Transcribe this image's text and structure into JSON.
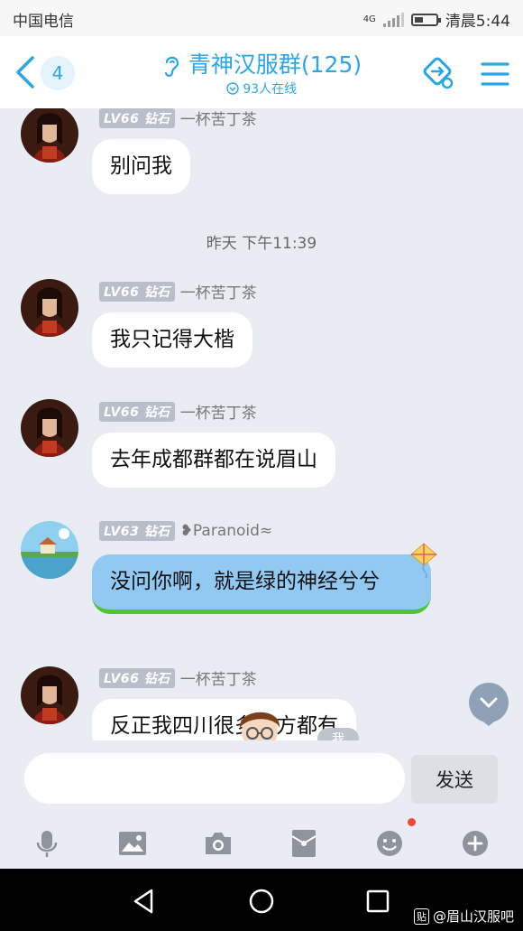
{
  "status_bar": {
    "carrier": "中国电信",
    "network": "4G",
    "time": "清晨5:44"
  },
  "header": {
    "unread_count": "4",
    "title": "青神汉服群(125)",
    "online": "93人在线"
  },
  "messages": [
    {
      "level": "LV66",
      "rank": "钻石",
      "nickname": "一杯苦丁茶",
      "text": "别问我"
    },
    {
      "level": "LV66",
      "rank": "钻石",
      "nickname": "一杯苦丁茶",
      "text": "我只记得大楷"
    },
    {
      "level": "LV66",
      "rank": "钻石",
      "nickname": "一杯苦丁茶",
      "text": "去年成都群都在说眉山"
    },
    {
      "level": "LV63",
      "rank": "钻石",
      "nickname": "❥Paranoid≈",
      "text": "没问你啊，就是绿的神经兮兮"
    },
    {
      "level": "LV66",
      "rank": "钻石",
      "nickname": "一杯苦丁茶",
      "text": "反正我四川很多地方都有"
    }
  ],
  "timestamp": "昨天 下午11:39",
  "me_tag": "我",
  "input": {
    "placeholder": "",
    "send_label": "发送"
  },
  "toolbar": {
    "icons": [
      "microphone-icon",
      "image-icon",
      "camera-icon",
      "red-packet-icon",
      "emoji-icon",
      "plus-icon"
    ]
  },
  "watermark": {
    "badge": "贴",
    "text": "@眉山汉服吧"
  },
  "colors": {
    "accent": "#29a6e6",
    "blue_bubble": "#91c9f3",
    "green_edge": "#4fc52f",
    "badge_dot": "#f2463c"
  }
}
